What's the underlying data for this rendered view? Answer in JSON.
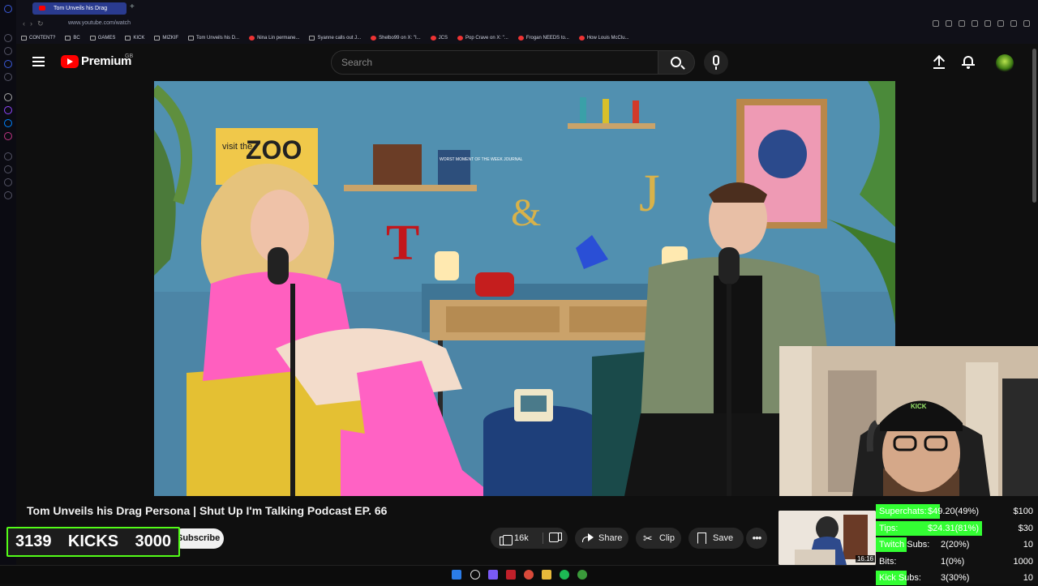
{
  "browser": {
    "active_tab_title": "Tom Unveils his Drag",
    "new_tab_symbol": "+",
    "url": "www.youtube.com/watch",
    "bookmarks": [
      "CONTENT?",
      "BC",
      "GAMES",
      "KICK",
      "MIZKIF",
      "Tom Unveils his D...",
      "Nina Lin permane...",
      "Syanne calls out J...",
      "Shelbo99 on X: \"I...",
      "JCS",
      "Pop Crave on X: \"...",
      "Frogan NEEDS to...",
      "How Louis McClu..."
    ]
  },
  "header": {
    "brand": "Premium",
    "region": "GB",
    "search_placeholder": "Search"
  },
  "video": {
    "title": "Tom Unveils his Drag Persona | Shut Up I'm Talking Podcast EP. 66",
    "subscribe_label": "Subscribe",
    "like_count": "16k",
    "share_label": "Share",
    "clip_label": "Clip",
    "save_label": "Save",
    "more_symbol": "•••"
  },
  "set_text": {
    "sign_visit": "visit the",
    "sign_zoo": "ZOO",
    "book_sign": "WORST MOMENT OF THE WEEK JOURNAL",
    "letter_t": "T",
    "letter_amp": "&",
    "letter_j": "J"
  },
  "webcam": {
    "cap_text": "KICK"
  },
  "kicks_goal": {
    "current": "3139",
    "label": "KICKS",
    "target": "3000"
  },
  "thumbnail": {
    "duration": "16:16"
  },
  "goals": [
    {
      "label": "Superchats:",
      "value": "$49.20(49%)",
      "target": "$100",
      "fraction": 0.49
    },
    {
      "label": "Tips:",
      "value": "$24.31(81%)",
      "target": "$30",
      "fraction": 0.81
    },
    {
      "label": "Twitch Subs:",
      "value": "2(20%)",
      "target": "10",
      "fraction": 0.2
    },
    {
      "label": "Bits:",
      "value": "1(0%)",
      "target": "1000",
      "fraction": 0.0
    },
    {
      "label": "Kick Subs:",
      "value": "3(30%)",
      "target": "10",
      "fraction": 0.3
    }
  ],
  "colors": {
    "accent_red": "#ff0000",
    "kick_green": "#53fc18",
    "goal_green": "#33ff33"
  }
}
